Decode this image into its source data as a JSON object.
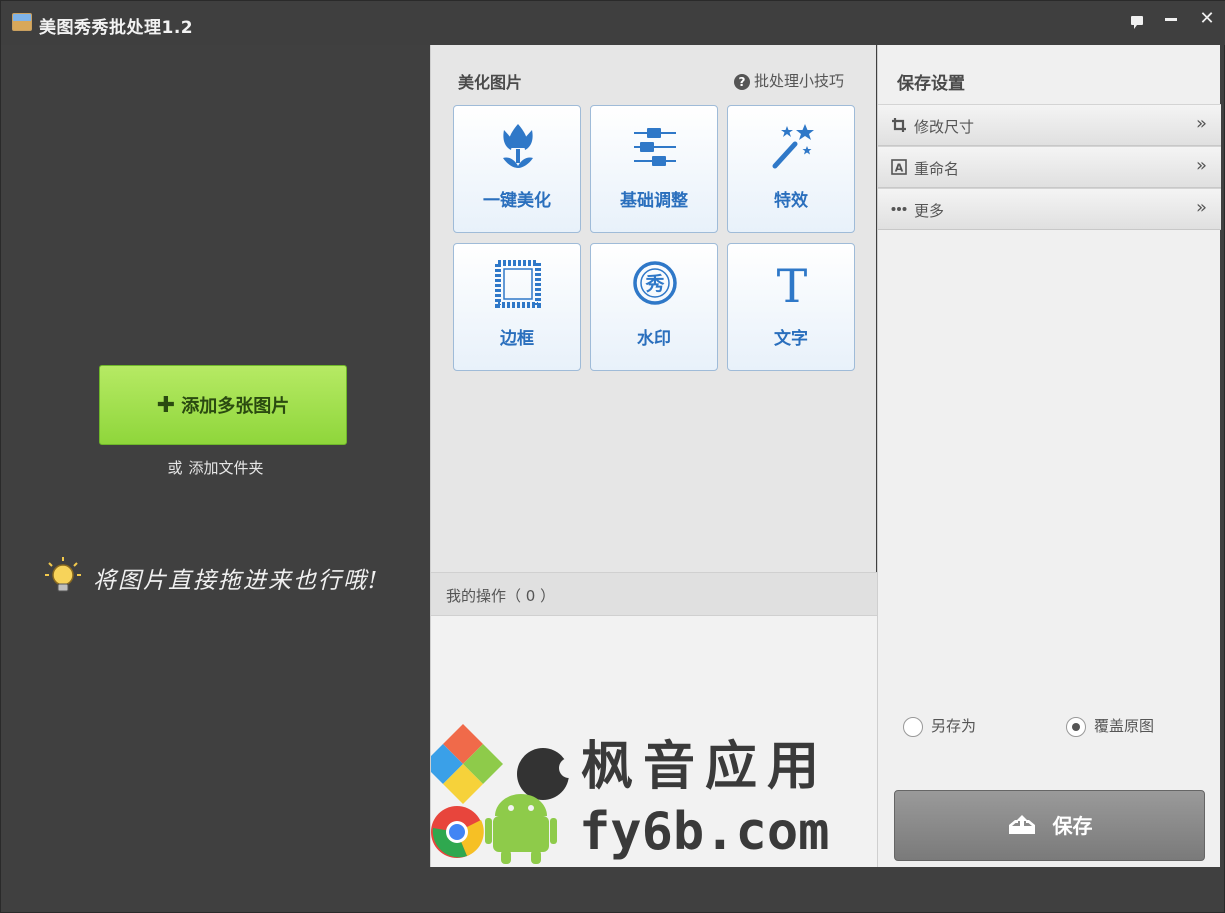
{
  "window": {
    "title": "美图秀秀批处理1.2"
  },
  "left": {
    "add_button_label": "添加多张图片",
    "or_label": "或",
    "add_folder_label": "添加文件夹",
    "drag_hint": "将图片直接拖进来也行哦!"
  },
  "middle": {
    "heading": "美化图片",
    "tips_label": "批处理小技巧",
    "tiles": [
      {
        "label": "一键美化",
        "icon": "tulip-icon"
      },
      {
        "label": "基础调整",
        "icon": "sliders-icon"
      },
      {
        "label": "特效",
        "icon": "magic-wand-icon"
      },
      {
        "label": "边框",
        "icon": "frame-icon"
      },
      {
        "label": "水印",
        "icon": "watermark-icon"
      },
      {
        "label": "文字",
        "icon": "text-icon"
      }
    ],
    "ops_label": "我的操作（ 0 ）",
    "watermark": {
      "line1": "枫音应用",
      "line2": "fy6b.com"
    }
  },
  "right": {
    "heading": "保存设置",
    "rows": [
      {
        "label": "修改尺寸",
        "icon": "crop-icon"
      },
      {
        "label": "重命名",
        "icon": "rename-icon"
      },
      {
        "label": "更多",
        "icon": "more-icon"
      }
    ],
    "save_as_label": "另存为",
    "overwrite_label": "覆盖原图",
    "save_button_label": "保存"
  },
  "colors": {
    "accent_blue": "#2a6fbd",
    "add_green": "#9ddc4a",
    "dark_bg": "#404040"
  }
}
